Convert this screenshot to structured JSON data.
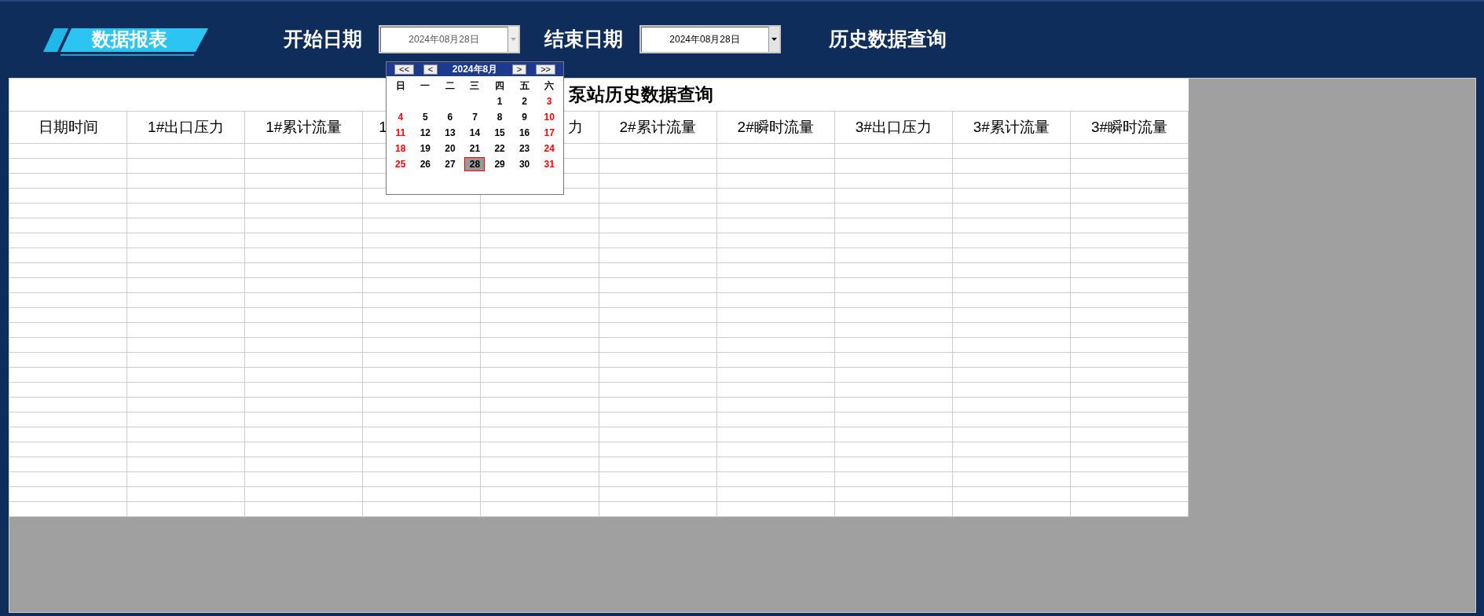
{
  "header": {
    "badge": "数据报表",
    "start_label": "开始日期",
    "start_date": {
      "value": "2024年08月28日",
      "open": true
    },
    "end_label": "结束日期",
    "end_date": {
      "value": "2024年08月28日",
      "open": false
    },
    "query_button": "历史数据查询"
  },
  "table": {
    "title": "泵站历史数据查询",
    "columns": [
      {
        "label": "日期时间"
      },
      {
        "label": "1#出口压力"
      },
      {
        "label": "1#累计流量"
      },
      {
        "label": "1"
      },
      {
        "label": "力"
      },
      {
        "label": "2#累计流量"
      },
      {
        "label": "2#瞬时流量"
      },
      {
        "label": "3#出口压力"
      },
      {
        "label": "3#累计流量"
      },
      {
        "label": "3#瞬时流量"
      }
    ]
  },
  "calendar": {
    "nav": [
      "<<",
      "<"
    ],
    "nav_end": [
      ">",
      ">>"
    ],
    "month": "2024年8月",
    "weekdays": [
      "日",
      "一",
      "二",
      "三",
      "四",
      "五",
      "六"
    ],
    "weeks": [
      [
        {
          "day": "1",
          "weekend": false,
          "selected": false
        },
        {
          "day": "2",
          "weekend": false,
          "selected": false
        },
        {
          "day": "3",
          "weekend": true,
          "selected": false
        }
      ],
      [
        {
          "day": "4",
          "weekend": true,
          "selected": false
        },
        {
          "day": "5",
          "weekend": false,
          "selected": false
        },
        {
          "day": "6",
          "weekend": false,
          "selected": false
        },
        {
          "day": "7",
          "weekend": false,
          "selected": false
        },
        {
          "day": "8",
          "weekend": false,
          "selected": false
        },
        {
          "day": "9",
          "weekend": false,
          "selected": false
        },
        {
          "day": "10",
          "weekend": true,
          "selected": false
        }
      ],
      [
        {
          "day": "11",
          "weekend": true,
          "selected": false
        },
        {
          "day": "12",
          "weekend": false,
          "selected": false
        },
        {
          "day": "13",
          "weekend": false,
          "selected": false
        },
        {
          "day": "14",
          "weekend": false,
          "selected": false
        },
        {
          "day": "15",
          "weekend": false,
          "selected": false
        },
        {
          "day": "16",
          "weekend": false,
          "selected": false
        },
        {
          "day": "17",
          "weekend": true,
          "selected": false
        }
      ],
      [
        {
          "day": "18",
          "weekend": true,
          "selected": false
        },
        {
          "day": "19",
          "weekend": false,
          "selected": false
        },
        {
          "day": "20",
          "weekend": false,
          "selected": false
        },
        {
          "day": "21",
          "weekend": false,
          "selected": false
        },
        {
          "day": "22",
          "weekend": false,
          "selected": false
        },
        {
          "day": "23",
          "weekend": false,
          "selected": false
        },
        {
          "day": "24",
          "weekend": true,
          "selected": false
        }
      ],
      [
        {
          "day": "25",
          "weekend": true,
          "selected": false
        },
        {
          "day": "26",
          "weekend": false,
          "selected": false
        },
        {
          "day": "27",
          "weekend": false,
          "selected": false
        },
        {
          "day": "28",
          "weekend": false,
          "selected": true
        },
        {
          "day": "29",
          "weekend": false,
          "selected": false
        },
        {
          "day": "30",
          "weekend": false,
          "selected": false
        },
        {
          "day": "31",
          "weekend": true,
          "selected": false
        }
      ]
    ]
  }
}
